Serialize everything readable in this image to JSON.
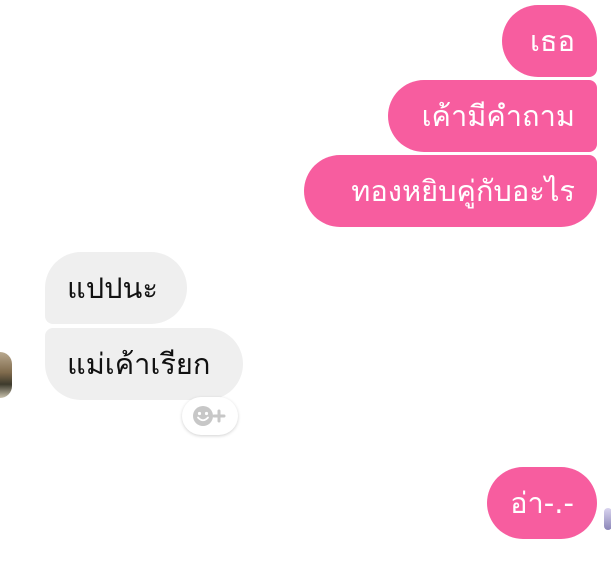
{
  "messages": [
    {
      "id": "m1",
      "direction": "outgoing",
      "text": "เธอ"
    },
    {
      "id": "m2",
      "direction": "outgoing",
      "text": "เค้ามีคำถาม"
    },
    {
      "id": "m3",
      "direction": "outgoing",
      "text": "ทองหยิบคู่กับอะไร"
    },
    {
      "id": "m4",
      "direction": "incoming",
      "text": "แปปนะ"
    },
    {
      "id": "m5",
      "direction": "incoming",
      "text": "แม่เค้าเรียก"
    },
    {
      "id": "m6",
      "direction": "outgoing",
      "text": "อ่า-.-"
    }
  ],
  "colors": {
    "outgoing_bubble": "#f75d9f",
    "incoming_bubble": "#efefef"
  },
  "icons": {
    "reaction": "smiley-plus-icon",
    "avatar": "contact-avatar",
    "seen": "seen-avatar-icon"
  }
}
